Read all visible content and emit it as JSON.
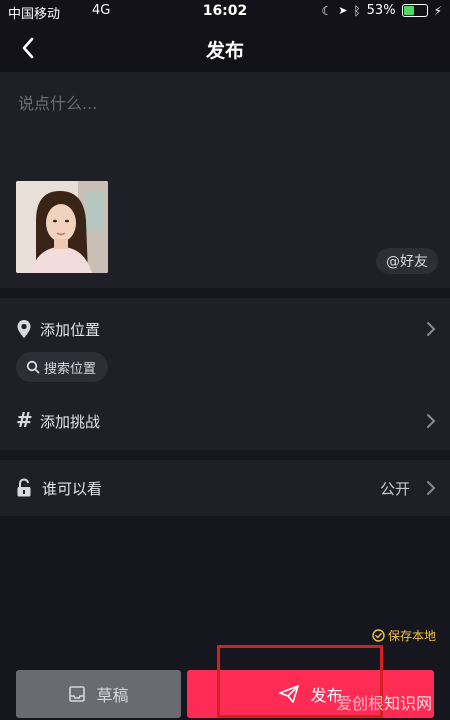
{
  "status_bar": {
    "carrier": "中国移动",
    "network": "4G",
    "time": "16:02",
    "battery": "53%",
    "battery_level": 0.53
  },
  "header": {
    "title": "发布"
  },
  "composer": {
    "caption_placeholder": "说点什么...",
    "friend_button": "@好友"
  },
  "options": {
    "location_label": "添加位置",
    "search_location": "搜索位置",
    "challenge_label": "添加挑战",
    "visibility_label": "谁可以看",
    "visibility_value": "公开"
  },
  "bottom": {
    "save_local": "保存本地",
    "draft_button": "草稿",
    "publish_button": "发布"
  },
  "watermark": {
    "part1": "爱创根",
    "part2": "知识网"
  },
  "colors": {
    "accent": "#fe2c55",
    "highlight": "#d61f1f",
    "save_local": "#f4c244"
  }
}
